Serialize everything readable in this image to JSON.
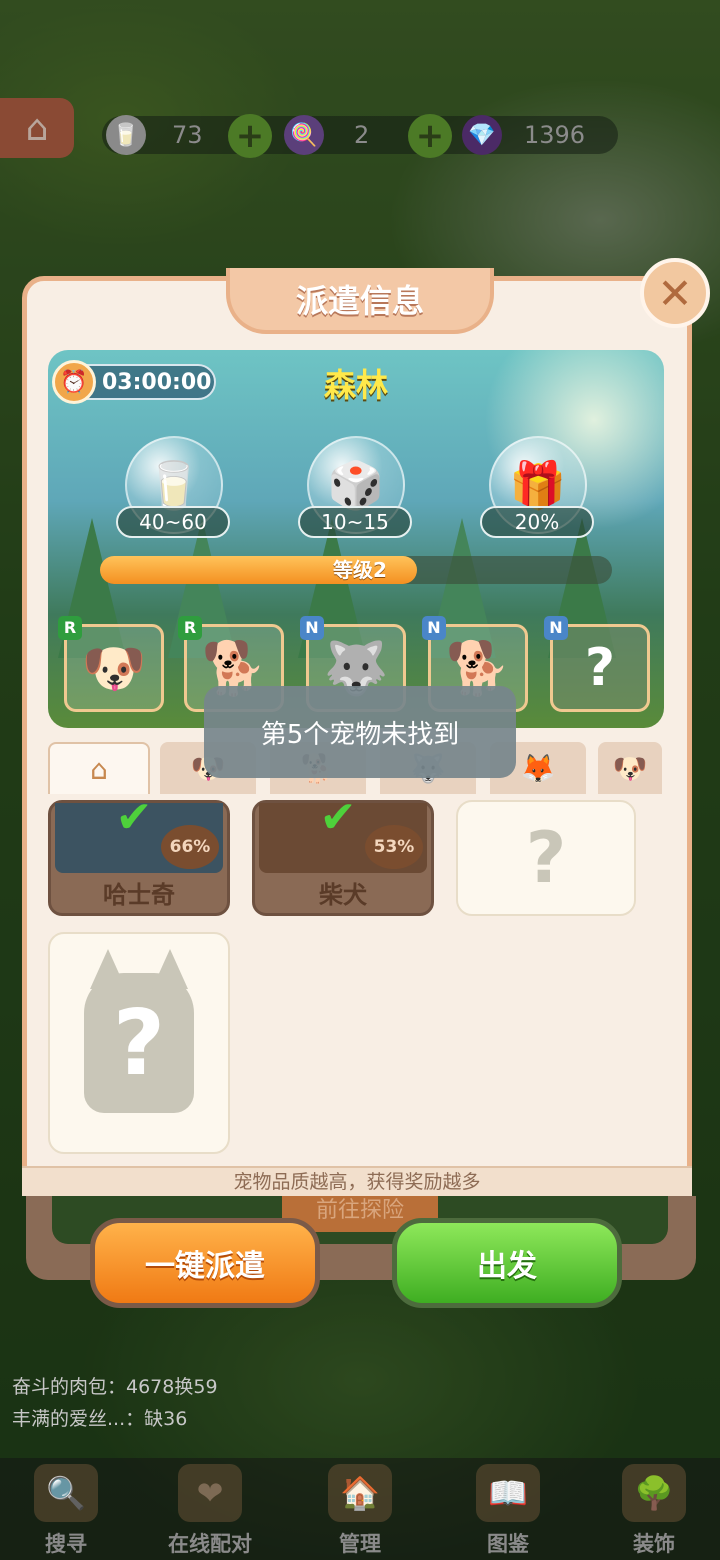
{
  "resources": {
    "milk": "73",
    "candy": "2",
    "gems": "1396"
  },
  "dialog": {
    "title": "派遣信息",
    "timer": "03:00:00",
    "location": "森林",
    "rewards": [
      "40~60",
      "10~15",
      "20%"
    ],
    "level_label": "等级2",
    "level_progress": 0.62,
    "team_slots": [
      {
        "rank": "R",
        "pet": "斗牛犬"
      },
      {
        "rank": "R",
        "pet": "柴犬"
      },
      {
        "rank": "N",
        "pet": "哈士奇"
      },
      {
        "rank": "N",
        "pet": "柴犬"
      },
      {
        "rank": "N",
        "pet": "?"
      }
    ],
    "pets": [
      {
        "name": "哈士奇",
        "percent": "66%"
      },
      {
        "name": "柴犬",
        "percent": "53%"
      }
    ],
    "unknown_mark": "?",
    "hint": "宠物品质越高，获得奖励越多"
  },
  "toast": "第5个宠物未找到",
  "behind_button": "前往探险",
  "buttons": {
    "auto_dispatch": "一键派遣",
    "depart": "出发"
  },
  "ticker": [
    "奋斗的肉包：4678换59",
    "丰满的爱丝...：缺36"
  ],
  "nav": [
    "搜寻",
    "在线配对",
    "管理",
    "图鉴",
    "装饰"
  ],
  "colors": {
    "accent_orange": "#f49021",
    "accent_green": "#3fae22",
    "dialog_bg": "#f8eee4"
  }
}
